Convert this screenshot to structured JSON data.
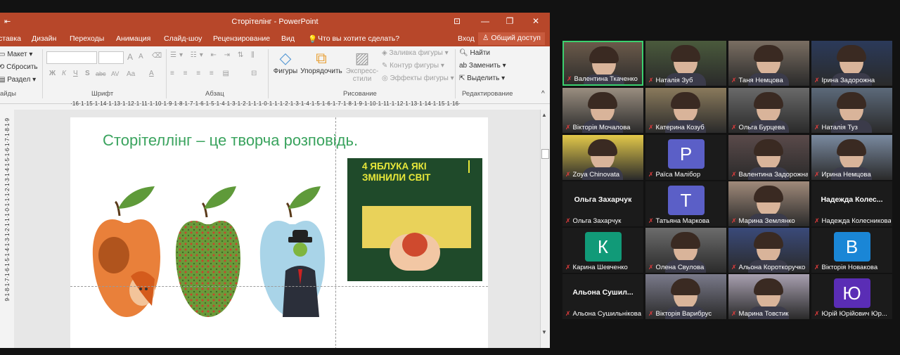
{
  "app": {
    "title": "Сторітелінг - PowerPoint",
    "controls": {
      "ribbon_options": "⊡",
      "minimize": "—",
      "restore": "❐",
      "close": "✕"
    },
    "quick_access": "⇤",
    "menu": [
      "ставка",
      "Дизайн",
      "Переходы",
      "Анимация",
      "Слайд-шоу",
      "Рецензирование",
      "Вид"
    ],
    "tell_me": "Что вы хотите сделать?",
    "signin": "Вход",
    "share": "Общий доступ"
  },
  "ribbon": {
    "slides": {
      "layout": "Макет",
      "reset": "Сбросить",
      "section": "Раздел",
      "group": "айды"
    },
    "font": {
      "group": "Шрифт",
      "grow": "A",
      "shrink": "A",
      "bold": "Ж",
      "italic": "К",
      "underline": "Ч",
      "shadow": "S",
      "strike": "abc",
      "spacing": "AV",
      "case": "Aa",
      "color": "A"
    },
    "paragraph": {
      "group": "Абзац"
    },
    "drawing": {
      "group": "Рисование",
      "shapes": "Фигуры",
      "arrange": "Упорядочить",
      "quick_styles_1": "Экспресс-",
      "quick_styles_2": "стили",
      "fill": "Заливка фигуры",
      "outline": "Контур фигуры",
      "effects": "Эффекты фигуры"
    },
    "editing": {
      "group": "Редактирование",
      "find": "Найти",
      "replace": "Заменить",
      "select": "Выделить"
    }
  },
  "ruler": {
    "horizontal": "·16·1·15·1·14·1·13·1·12·1·11·1·10·1·9·1·8·1·7·1·6·1·5·1·4·1·3·1·2·1·1·1·0·1·1·1·2·1·3·1·4·1·5·1·6·1·7·1·8·1·9·1·10·1·11·1·12·1·13·1·14·1·15·1·16·",
    "vertical": "9·1·8·1·7·1·6·1·5·1·4·1·3·1·2·1·1·1·0·1·1·1·2·1·3·1·4·1·5·1·6·1·7·1·8·1·9"
  },
  "slide": {
    "title": "Сторітеллінг – це творча розповідь.",
    "book_cover": "4 ЯБЛУКА ЯКІ ЗМІНИЛИ СВІТ"
  },
  "participants": [
    {
      "name": "Валентина Ткаченко",
      "active": true
    },
    {
      "name": "Наталія Зуб"
    },
    {
      "name": "Таня Немцова"
    },
    {
      "name": "Ірина Задорожна"
    },
    {
      "name": "Вікторія Мочалова"
    },
    {
      "name": "Катерина Козуб"
    },
    {
      "name": "Ольга Бурцева"
    },
    {
      "name": "Наталія Туз"
    },
    {
      "name": "Zoya Chinovata"
    },
    {
      "name": "Раїса Малібор",
      "initial": "Р",
      "color": "#5b5fc7"
    },
    {
      "name": "Валентина Задорожна"
    },
    {
      "name": "Ирина Немцова"
    },
    {
      "name": "Ольга Захарчук",
      "label": "Ольга Захарчук"
    },
    {
      "name": "Татьяна Маркова",
      "initial": "Т",
      "color": "#5b5fc7"
    },
    {
      "name": "Марина Землянко"
    },
    {
      "name": "Надежда Колесникова",
      "label": "Надежда Колес..."
    },
    {
      "name": "Карина Шевченко",
      "initial": "К",
      "color": "#119a78"
    },
    {
      "name": "Олена Свулова"
    },
    {
      "name": "Альона Короткоручко"
    },
    {
      "name": "Вікторія Новакова",
      "initial": "В",
      "color": "#1a86d6"
    },
    {
      "name": "Альона Сушильнікова",
      "label": "Альона Сушил..."
    },
    {
      "name": "Вікторія Варибрус"
    },
    {
      "name": "Марина Товстик"
    },
    {
      "name": "Юрій Юрійович Юр...",
      "initial": "Ю",
      "color": "#5a2db5"
    }
  ]
}
